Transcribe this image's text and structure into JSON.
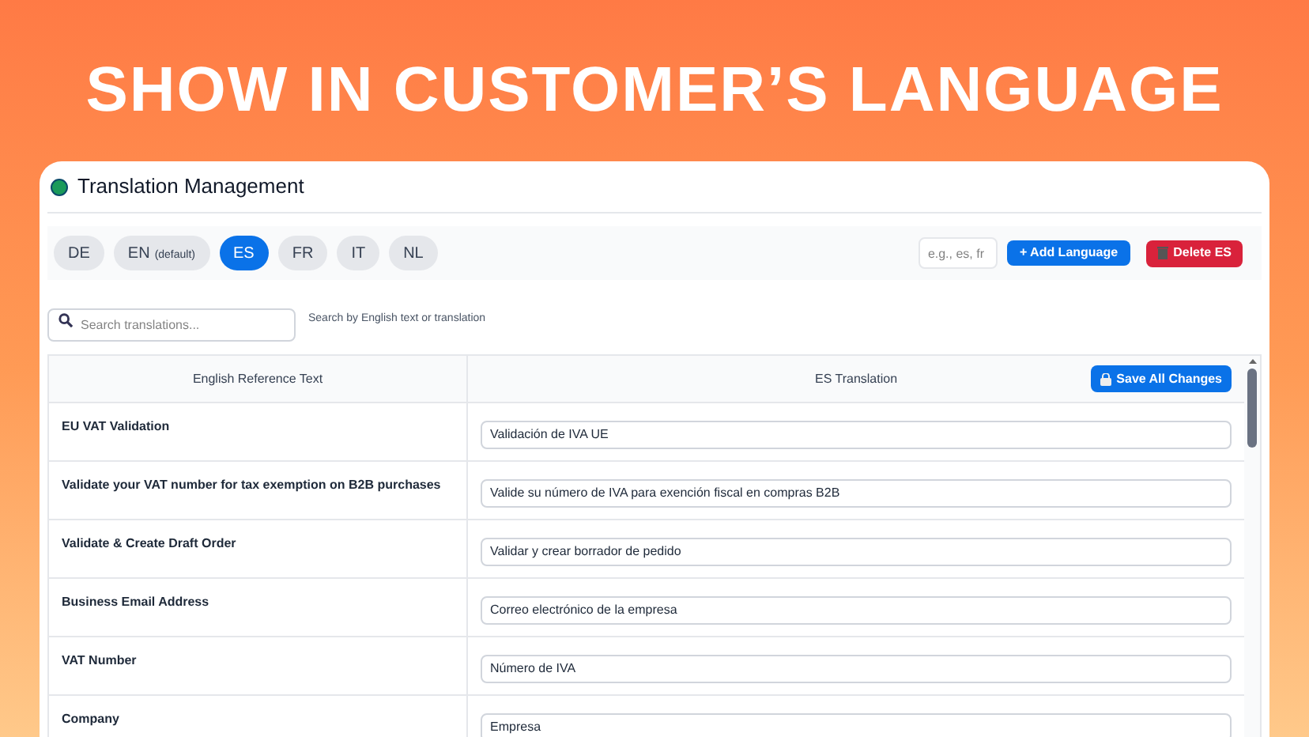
{
  "headline": "SHOW IN CUSTOMER’S LANGUAGE",
  "window": {
    "title": "Translation Management"
  },
  "languages": [
    {
      "code": "DE",
      "selected": false
    },
    {
      "code": "EN",
      "note": "(default)",
      "selected": false
    },
    {
      "code": "ES",
      "selected": true
    },
    {
      "code": "FR",
      "selected": false
    },
    {
      "code": "IT",
      "selected": false
    },
    {
      "code": "NL",
      "selected": false
    }
  ],
  "language_field": {
    "placeholder": "e.g., es, fr"
  },
  "add_button": "+ Add Language",
  "delete_button": "Delete ES",
  "search": {
    "placeholder": "Search translations...",
    "hint": "Search by English text or translation"
  },
  "table": {
    "columns": [
      "English Reference Text",
      "ES Translation"
    ],
    "save_button": "Save All Changes",
    "rows": [
      {
        "english": "EU VAT Validation",
        "translation": "Validación de IVA UE"
      },
      {
        "english": "Validate your VAT number for tax exemption on B2B purchases",
        "translation": "Valide su número de IVA para exención fiscal en compras B2B"
      },
      {
        "english": "Validate & Create Draft Order",
        "translation": "Validar y crear borrador de pedido"
      },
      {
        "english": "Business Email Address",
        "translation": "Correo electrónico de la empresa"
      },
      {
        "english": "VAT Number",
        "translation": "Número de IVA"
      },
      {
        "english": "Company",
        "translation": "Empresa"
      }
    ]
  }
}
